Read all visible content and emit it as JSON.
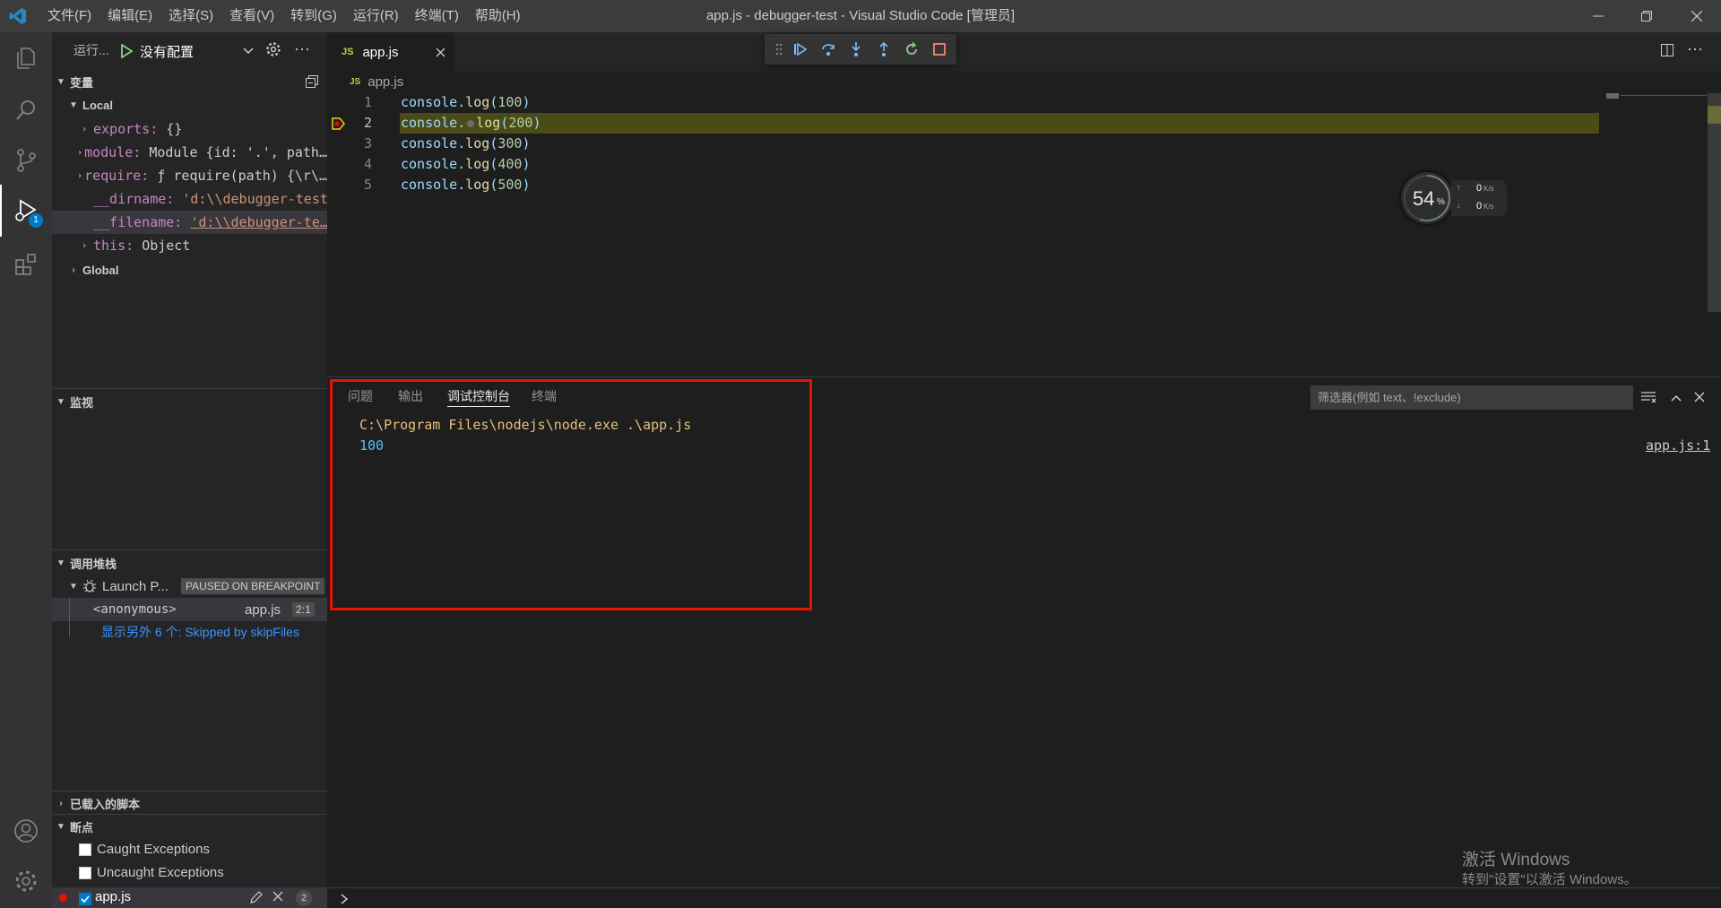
{
  "titlebar": {
    "menu": [
      "文件(F)",
      "编辑(E)",
      "选择(S)",
      "查看(V)",
      "转到(G)",
      "运行(R)",
      "终端(T)",
      "帮助(H)"
    ],
    "window_title": "app.js - debugger-test - Visual Studio Code [管理员]"
  },
  "run": {
    "label": "运行...",
    "config": "没有配置"
  },
  "variables": {
    "header": "变量",
    "local_label": "Local",
    "items": [
      {
        "name": "exports:",
        "value": "{}"
      },
      {
        "name": "module:",
        "value": "Module {id: '.', path…"
      },
      {
        "name": "require:",
        "value": "ƒ require(path) {\\r\\…"
      },
      {
        "name": "__dirname:",
        "value": "'d:\\\\debugger-test'"
      },
      {
        "name": "__filename:",
        "value": "'d:\\\\debugger-te…"
      },
      {
        "name": "this:",
        "value": "Object"
      }
    ],
    "global_label": "Global"
  },
  "watch": {
    "header": "监视"
  },
  "callstack": {
    "header": "调用堆栈",
    "session": "Launch P...",
    "status": "PAUSED ON BREAKPOINT",
    "frame_name": "<anonymous>",
    "frame_file": "app.js",
    "frame_pos": "2:1",
    "skipped": "显示另外 6 个: Skipped by skipFiles"
  },
  "loaded_scripts": {
    "header": "已载入的脚本"
  },
  "breakpoints": {
    "header": "断点",
    "caught": "Caught Exceptions",
    "uncaught": "Uncaught Exceptions",
    "file": "app.js",
    "count": "2"
  },
  "editor": {
    "tab": "app.js",
    "tab_icon": "JS",
    "breadcrumb": "app.js",
    "lines": [
      {
        "n": "1",
        "obj": "console.",
        "fn": "log",
        "arg": "100"
      },
      {
        "n": "2",
        "obj": "console.",
        "fn": "log",
        "arg": "200"
      },
      {
        "n": "3",
        "obj": "console.",
        "fn": "log",
        "arg": "300"
      },
      {
        "n": "4",
        "obj": "console.",
        "fn": "log",
        "arg": "400"
      },
      {
        "n": "5",
        "obj": "console.",
        "fn": "log",
        "arg": "500"
      }
    ]
  },
  "panel": {
    "tabs": [
      "问题",
      "输出",
      "调试控制台",
      "终端"
    ],
    "active_tab": "调试控制台",
    "filter_placeholder": "筛选器(例如 text、!exclude)",
    "console_cmd": "C:\\Program Files\\nodejs\\node.exe .\\app.js",
    "console_out": "100",
    "source_link": "app.js:1"
  },
  "net_widget": {
    "percent": "54",
    "percent_unit": "%",
    "up": "0",
    "down": "0",
    "unit": "K/s"
  },
  "watermark": {
    "line1": "激活 Windows",
    "line2": "转到\"设置\"以激活 Windows。"
  },
  "colors": {
    "accent": "#007acc",
    "breakpoint_line": "#4b4b18",
    "highlight_box": "#e51400"
  }
}
